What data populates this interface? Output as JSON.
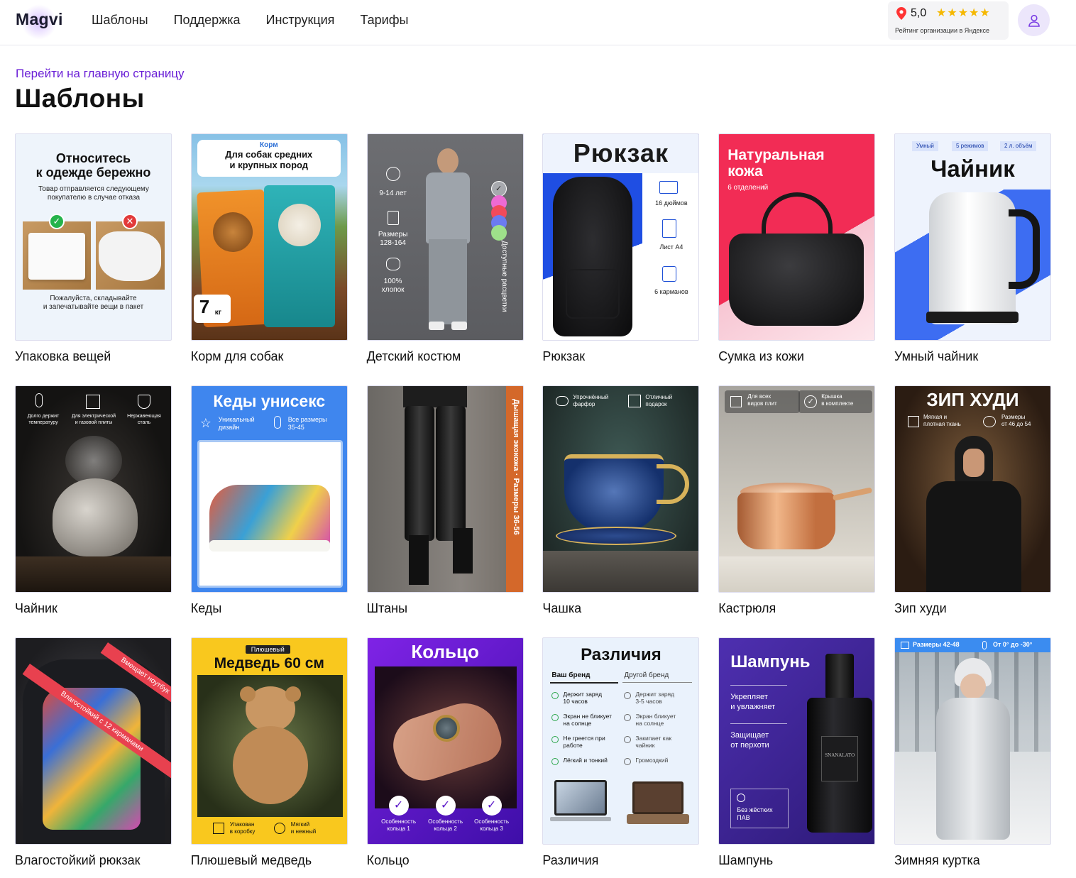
{
  "header": {
    "logo": "Magvi",
    "nav": [
      "Шаблоны",
      "Поддержка",
      "Инструкция",
      "Тарифы"
    ],
    "rating": {
      "score": "5,0",
      "stars": "★★★★★",
      "caption": "Рейтинг организации в Яндексе"
    }
  },
  "back_link": "Перейти на главную страницу",
  "page_title": "Шаблоны",
  "cards": [
    {
      "label": "Упаковка вещей",
      "thumb": {
        "title": "Относитесь\nк одежде бережно",
        "subtitle": "Товар отправляется следующему покупателю в случае отказа",
        "footer": "Пожалуйста, складывайте\nи запечатывайте вещи в пакет"
      }
    },
    {
      "label": "Корм для собак",
      "thumb": {
        "tag": "Корм",
        "title": "Для собак средних\nи крупных пород",
        "weight": "7",
        "unit": "кг"
      }
    },
    {
      "label": "Детский костюм",
      "thumb": {
        "f1": "9-14 лет",
        "f2": "Размеры\n128-164",
        "f3": "100%\nхлопок",
        "side": "Доступные расцветки"
      }
    },
    {
      "label": "Рюкзак",
      "thumb": {
        "title": "Рюкзак",
        "f1": "16 дюймов",
        "f2": "Лист А4",
        "f3": "6 карманов"
      }
    },
    {
      "label": "Сумка из кожи",
      "thumb": {
        "title": "Натуральная\nкожа",
        "subtitle": "6 отделений"
      }
    },
    {
      "label": "Умный чайник",
      "thumb": {
        "chips": [
          "Умный",
          "5 режимов",
          "2 л. объём"
        ],
        "title": "Чайник"
      }
    },
    {
      "label": "Чайник",
      "thumb": {
        "f1": "Долго держит\nтемпературу",
        "f2": "Для электрической\nи газовой плиты",
        "f3": "Нержавеющая\nсталь"
      }
    },
    {
      "label": "Кеды",
      "thumb": {
        "title": "Кеды унисекс",
        "f1": "Уникальный\nдизайн",
        "f2": "Все размеры\n35-45"
      }
    },
    {
      "label": "Штаны",
      "thumb": {
        "side": "Дышащая экокожа · Размеры 36-56"
      }
    },
    {
      "label": "Чашка",
      "thumb": {
        "f1": "Упрочнённый\nфарфор",
        "f2": "Отличный\nподарок"
      }
    },
    {
      "label": "Кастрюля",
      "thumb": {
        "f1": "Для всех\nвидов плит",
        "f2": "Крышка\nв комплекте"
      }
    },
    {
      "label": "Зип худи",
      "thumb": {
        "title": "ЗИП ХУДИ",
        "f1": "Мягкая и\nплотная ткань",
        "f2": "Размеры\nот 46 до 54"
      }
    },
    {
      "label": "Влагостойкий рюкзак",
      "thumb": {
        "r1": "Влагостойкий с 12 карманами",
        "r2": "Вмещает ноутбук"
      }
    },
    {
      "label": "Плюшевый медведь",
      "thumb": {
        "tag": "Плюшевый",
        "title": "Медведь 60 см",
        "f1": "Упакован\nв коробку",
        "f2": "Мягкий\nи нежный"
      }
    },
    {
      "label": "Кольцо",
      "thumb": {
        "title": "Кольцо",
        "f1": "Особенность\nкольца 1",
        "f2": "Особенность\nкольца 2",
        "f3": "Особенность\nкольца 3"
      }
    },
    {
      "label": "Различия",
      "thumb": {
        "title": "Различия",
        "col1": "Ваш бренд",
        "col2": "Другой бренд",
        "left": [
          "Держит заряд\n10 часов",
          "Экран не бликует\nна солнце",
          "Не греется при\nработе",
          "Лёгкий и тонкий"
        ],
        "right": [
          "Держит заряд\n3-5 часов",
          "Экран бликует\nна солнце",
          "Закипает как\nчайник",
          "Громоздкий"
        ]
      }
    },
    {
      "label": "Шампунь",
      "thumb": {
        "title": "Шампунь",
        "f1": "Укрепляет\nи увлажняет",
        "f2": "Защищает\nот перхоти",
        "f3": "Без жёстких\nПАВ",
        "brand": "SNANALATO"
      }
    },
    {
      "label": "Зимняя куртка",
      "thumb": {
        "f1": "Размеры 42-48",
        "f2": "От 0° до -30°"
      }
    }
  ]
}
